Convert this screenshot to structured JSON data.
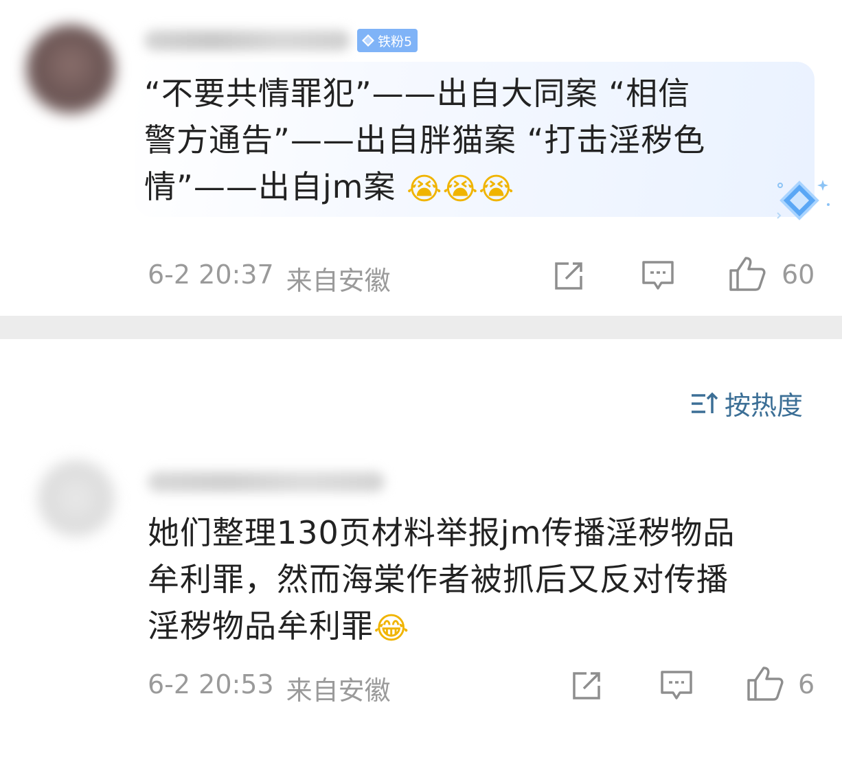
{
  "comments": [
    {
      "badge": "铁粉5",
      "text_lines": [
        "“不要共情罪犯”——出自大同案 “相信",
        "警方通告”——出自胖猫案 “打击淫秽色",
        "情”——出自jm案 "
      ],
      "emojis": "😭😭😭",
      "timestamp": "6-2 20:37",
      "location": "来自安徽",
      "likes": "60"
    },
    {
      "text_lines": [
        "她们整理130页材料举报jm传播淫秽物品",
        "牟利罪，然而海棠作者被抓后又反对传播",
        "淫秽物品牟利罪"
      ],
      "emojis": "😂",
      "timestamp": "6-2 20:53",
      "location": "来自安徽",
      "likes": "6"
    }
  ],
  "sort": {
    "label": "按热度",
    "icon": "sort-icon"
  },
  "icons": {
    "share": "share-icon",
    "reply": "comment-icon",
    "like": "thumbs-up-icon",
    "badge": "diamond-icon"
  },
  "colors": {
    "badge_bg": "#7fb3f7",
    "sort_text": "#3c6f96",
    "meta_text": "#9a9a9a",
    "highlight_bubble": "#eaf2ff"
  }
}
